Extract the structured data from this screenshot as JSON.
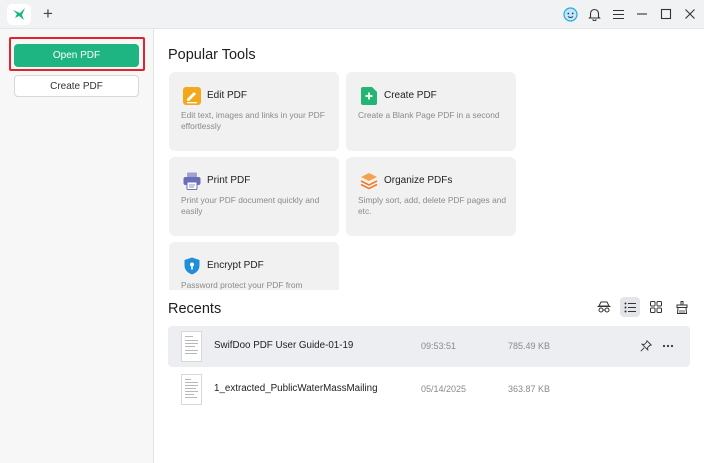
{
  "titlebar": {
    "new_tab_label": "+"
  },
  "sidebar": {
    "open_label": "Open PDF",
    "create_label": "Create PDF"
  },
  "popular_tools": {
    "title": "Popular Tools",
    "tools": [
      {
        "name": "Edit PDF",
        "desc": "Edit text, images and links in your PDF effortlessly",
        "icon": "edit-pdf-icon",
        "color": "#f3a81b"
      },
      {
        "name": "Create PDF",
        "desc": "Create a Blank Page PDF in a second",
        "icon": "create-pdf-icon",
        "color": "#22b573"
      },
      {
        "name": "Print PDF",
        "desc": "Print your PDF document quickly and easily",
        "icon": "printer-icon",
        "color": "#6a6fb8"
      },
      {
        "name": "Organize PDFs",
        "desc": "Simply sort, add, delete PDF pages and etc.",
        "icon": "stack-icon",
        "color": "#f07c2a"
      },
      {
        "name": "Encrypt PDF",
        "desc": "Password protect your PDF from",
        "icon": "shield-lock-icon",
        "color": "#1e8fd8"
      }
    ]
  },
  "recents": {
    "title": "Recents",
    "files": [
      {
        "name": "SwifDoo PDF User Guide-01-19",
        "time": "09:53:51",
        "size": "785.49 KB"
      },
      {
        "name": "1_extracted_PublicWaterMassMailing",
        "time": "05/14/2025",
        "size": "363.87 KB"
      }
    ]
  },
  "colors": {
    "accent": "#1fb583",
    "highlight_border": "#e0242b"
  }
}
